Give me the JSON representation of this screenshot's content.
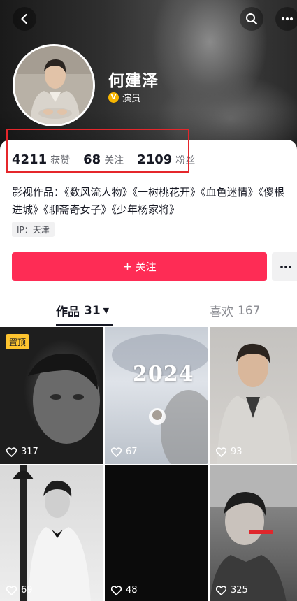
{
  "profile": {
    "name": "何建泽",
    "verification": "演员"
  },
  "stats": [
    {
      "value": "4211",
      "label": "获赞"
    },
    {
      "value": "68",
      "label": "关注"
    },
    {
      "value": "2109",
      "label": "粉丝"
    }
  ],
  "bio": "影视作品：《数风流人物》《一树桃花开》《血色迷情》《傻根进城》《聊斋奇女子》《少年杨家将》",
  "ip": "IP：天津",
  "actions": {
    "follow_icon": "+",
    "follow_label": "关注"
  },
  "tabs": {
    "works_label": "作品",
    "works_count": "31",
    "likes_label": "喜欢",
    "likes_count": "167"
  },
  "videos": [
    {
      "likes": "317",
      "pinned_label": "置顶"
    },
    {
      "likes": "67",
      "overlay_title": "2024"
    },
    {
      "likes": "93"
    },
    {
      "likes": "69"
    },
    {
      "likes": "48"
    },
    {
      "likes": "325"
    }
  ],
  "colors": {
    "accent": "#fe2c55",
    "highlight_box": "#e5262b",
    "pin_badge": "#fec42f",
    "verify_badge": "#f7b500"
  },
  "icons": [
    "back-icon",
    "search-icon",
    "more-icon",
    "verified-icon",
    "heart-icon"
  ]
}
